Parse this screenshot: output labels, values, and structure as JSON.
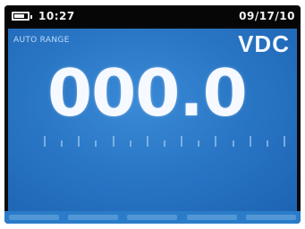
{
  "status_bar": {
    "time": "10:27",
    "date": "09/17/10",
    "battery_level": 0.8,
    "icon": "battery-icon"
  },
  "display": {
    "range_label": "AUTO RANGE",
    "unit": "VDC",
    "reading": "000.0"
  },
  "colors": {
    "screen_bg": "#2a77c6",
    "status_bg": "#060606",
    "text": "#f6f9ff"
  },
  "bargraph": {
    "tick_count": 15,
    "value": 0
  },
  "softkeys": {
    "count": 5
  }
}
